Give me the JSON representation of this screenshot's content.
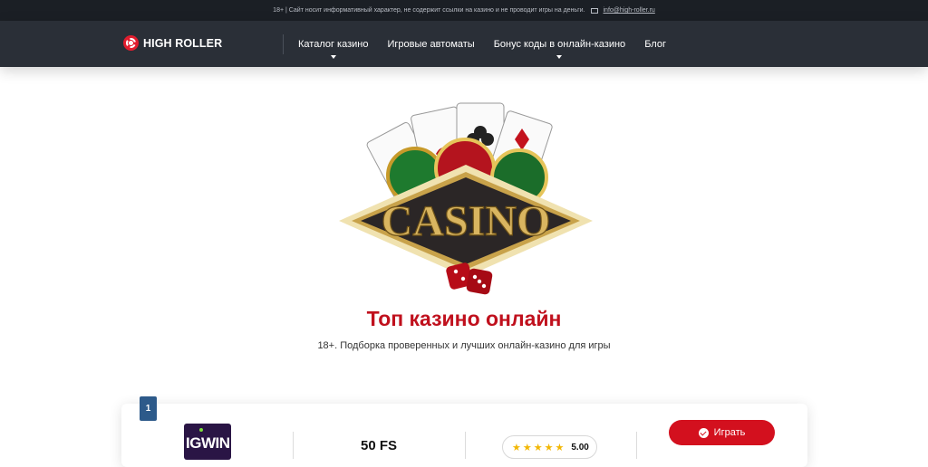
{
  "topbar": {
    "disclaimer": "18+ | Сайт носит информативный характер, не содержит ссылки на казино и не проводит игры на деньги.",
    "email": "info@high-roller.ru"
  },
  "header": {
    "logo_text": "HIGH ROLLER",
    "menu": [
      {
        "label": "Каталог казино",
        "has_dropdown": true
      },
      {
        "label": "Игровые автоматы",
        "has_dropdown": false
      },
      {
        "label": "Бонус коды в онлайн-казино",
        "has_dropdown": true
      },
      {
        "label": "Блог",
        "has_dropdown": false
      }
    ]
  },
  "hero": {
    "logo_word": "CASINO",
    "title": "Топ казино онлайн",
    "subtitle": "18+. Подборка проверенных и лучших онлайн-казино для игры"
  },
  "listing": {
    "rank": "1",
    "casino_logo_text": "IGWIN",
    "bonus": "50 FS",
    "rating": "5.00",
    "stars": 5,
    "play_label": "Играть"
  },
  "colors": {
    "accent": "#c0101d",
    "button": "#d3101e",
    "nav_bg": "#2a2f37",
    "topbar_bg": "#1b1f25",
    "rank_bg": "#2d5a8a",
    "star": "#f2b705"
  }
}
